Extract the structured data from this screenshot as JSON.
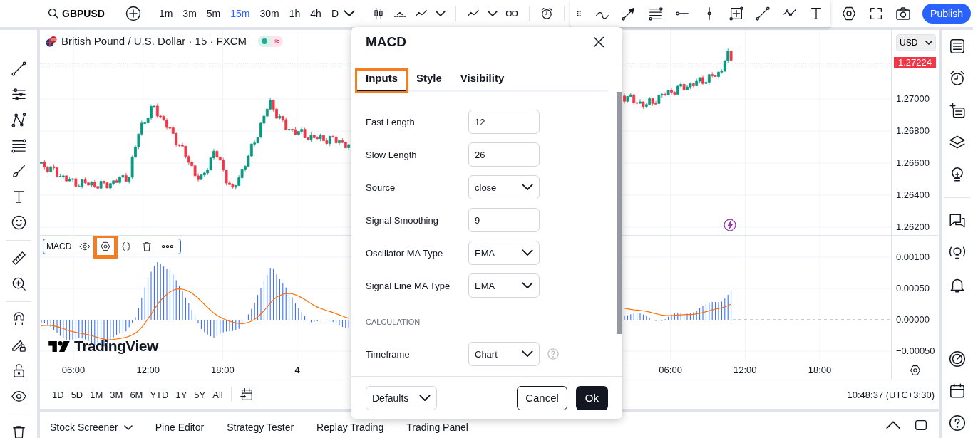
{
  "top_bar": {
    "symbol": "GBPUSD",
    "intervals": [
      {
        "label": "1m",
        "selected": false
      },
      {
        "label": "3m",
        "selected": false
      },
      {
        "label": "5m",
        "selected": false
      },
      {
        "label": "15m",
        "selected": true
      },
      {
        "label": "30m",
        "selected": false
      },
      {
        "label": "1h",
        "selected": false
      },
      {
        "label": "4h",
        "selected": false
      },
      {
        "label": "D",
        "selected": false
      }
    ],
    "publish_button": "Publish"
  },
  "chart": {
    "legend": {
      "title": "British Pound / U.S. Dollar · 15 · FXCM",
      "status_mark": "≈"
    },
    "currency": "USD",
    "last_price": "1.27224",
    "price_ticks": [
      "1.27000",
      "1.26800",
      "1.26600",
      "1.26400",
      "1.26200"
    ],
    "indicator": {
      "name": "MACD",
      "tools": [
        {
          "kind": "visibility",
          "highlighted": false
        },
        {
          "kind": "settings",
          "highlighted": true
        },
        {
          "kind": "source",
          "highlighted": false
        },
        {
          "kind": "delete",
          "highlighted": false
        },
        {
          "kind": "more",
          "highlighted": false
        }
      ],
      "ticks": [
        "0.00100",
        "0.00050",
        "0.00000",
        "−0.00050"
      ]
    },
    "logo_text": "TradingView",
    "time_labels_left": [
      {
        "label": "06:00",
        "bold": false
      },
      {
        "label": "12:00",
        "bold": false
      },
      {
        "label": "18:00",
        "bold": false
      },
      {
        "label": "4",
        "bold": true
      }
    ],
    "time_labels_right": [
      {
        "label": "06:00",
        "bold": false
      },
      {
        "label": "12:00",
        "bold": false
      },
      {
        "label": "18:00",
        "bold": false
      }
    ]
  },
  "range_bar": {
    "ranges": [
      "1D",
      "5D",
      "1M",
      "3M",
      "6M",
      "YTD",
      "1Y",
      "5Y",
      "All"
    ],
    "clock": "10:48:37 (UTC+3:30)"
  },
  "bottom_panel": {
    "tabs": [
      {
        "label": "Stock Screener",
        "has_menu": true
      },
      {
        "label": "Pine Editor",
        "has_menu": false
      },
      {
        "label": "Strategy Tester",
        "has_menu": false
      },
      {
        "label": "Replay Trading",
        "has_menu": false
      },
      {
        "label": "Trading Panel",
        "has_menu": false
      }
    ]
  },
  "dialog": {
    "title": "MACD",
    "tabs": [
      {
        "label": "Inputs",
        "selected": true,
        "highlighted": true
      },
      {
        "label": "Style",
        "selected": false,
        "highlighted": false
      },
      {
        "label": "Visibility",
        "selected": false,
        "highlighted": false
      }
    ],
    "inputs": [
      {
        "label": "Fast Length",
        "kind": "number",
        "value": "12"
      },
      {
        "label": "Slow Length",
        "kind": "number",
        "value": "26"
      },
      {
        "label": "Source",
        "kind": "select",
        "value": "close"
      },
      {
        "label": "Signal Smoothing",
        "kind": "number",
        "value": "9"
      },
      {
        "label": "Oscillator MA Type",
        "kind": "select",
        "value": "EMA"
      },
      {
        "label": "Signal Line MA Type",
        "kind": "select",
        "value": "EMA"
      }
    ],
    "section": "CALCULATION",
    "calculation_inputs": [
      {
        "label": "Timeframe",
        "kind": "select",
        "value": "Chart",
        "help": true
      }
    ],
    "defaults_button": "Defaults",
    "cancel_button": "Cancel",
    "ok_button": "Ok"
  }
}
